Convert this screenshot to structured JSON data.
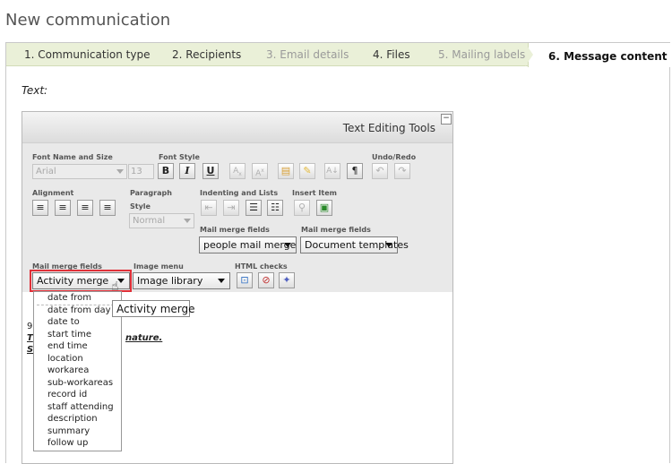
{
  "page": {
    "title": "New communication"
  },
  "wizard": {
    "tabs": [
      {
        "label": "1. Communication type",
        "state": "done"
      },
      {
        "label": "2. Recipients",
        "state": "done"
      },
      {
        "label": "3. Email details",
        "state": "disabled"
      },
      {
        "label": "4. Files",
        "state": "done"
      },
      {
        "label": "5. Mailing labels",
        "state": "disabled"
      },
      {
        "label": "6. Message content",
        "state": "active"
      }
    ]
  },
  "form": {
    "text_label": "Text:"
  },
  "editor": {
    "title": "Text Editing Tools",
    "collapse_symbol": "−",
    "groups": {
      "font_name_size": "Font Name and Size",
      "font_style": "Font Style",
      "undo_redo": "Undo/Redo",
      "alignment": "Alignment",
      "paragraph_style_1": "Paragraph",
      "paragraph_style_2": "Style",
      "indenting": "Indenting and Lists",
      "insert_item": "Insert Item",
      "mail_merge_1": "Mail merge fields",
      "mail_merge_2": "Mail merge fields",
      "mail_merge_3": "Mail merge fields",
      "image_menu": "Image menu",
      "html_checks": "HTML checks"
    },
    "font_name": "Arial",
    "font_size": "13",
    "paragraph_style": "Normal",
    "buttons": {
      "bold": "B",
      "italic": "I",
      "underline": "U"
    },
    "people_merge": "people mail merge",
    "doc_templates": "Document templates",
    "activity_merge": "Activity merge",
    "image_library": "Image library"
  },
  "dropdown": {
    "items": [
      "date from",
      "date from day",
      "date to",
      "start time",
      "end time",
      "location",
      "workarea",
      "sub-workareas",
      "record id",
      "staff attending",
      "description",
      "summary",
      "follow up"
    ]
  },
  "tooltip": {
    "text": "Activity merge"
  },
  "content": {
    "frag1": "9",
    "frag2": "T",
    "frag3": "nature.",
    "frag4": "S"
  },
  "colors": {
    "tab_bar": "#eaf0d8",
    "highlight": "#e03038"
  }
}
